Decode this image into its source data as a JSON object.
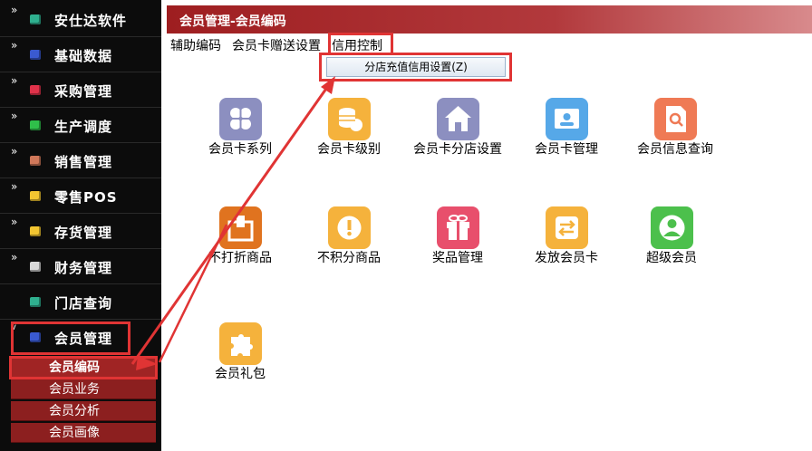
{
  "sidebar": {
    "items": [
      {
        "label": "安仕达软件",
        "color": "#2fb08f"
      },
      {
        "label": "基础数据",
        "color": "#3a5ad0"
      },
      {
        "label": "采购管理",
        "color": "#e0324a"
      },
      {
        "label": "生产调度",
        "color": "#2fbf4a"
      },
      {
        "label": "销售管理",
        "color": "#d0785a"
      },
      {
        "label": "零售POS",
        "color": "#f2c531"
      },
      {
        "label": "存货管理",
        "color": "#f2c531"
      },
      {
        "label": "财务管理",
        "color": "#d8d8d8"
      },
      {
        "label": "门店查询",
        "color": "#2fb08f"
      },
      {
        "label": "会员管理",
        "color": "#3a5ad0"
      }
    ],
    "subitems": [
      {
        "label": "会员编码"
      },
      {
        "label": "会员业务"
      },
      {
        "label": "会员分析"
      },
      {
        "label": "会员画像"
      }
    ]
  },
  "main": {
    "title": "会员管理-会员编码",
    "menu": [
      "辅助编码",
      "会员卡赠送设置",
      "信用控制"
    ],
    "dropdown_item": "分店充值信用设置(Z)",
    "tiles": [
      {
        "label": "会员卡系列",
        "icon": "grid-icon",
        "color": "#8c8fc0"
      },
      {
        "label": "会员卡级别",
        "icon": "coins-icon",
        "color": "#f5b23c"
      },
      {
        "label": "会员卡分店设置",
        "icon": "house-icon",
        "color": "#8c8fc0"
      },
      {
        "label": "会员卡管理",
        "icon": "id-card-icon",
        "color": "#56a8e8"
      },
      {
        "label": "会员信息查询",
        "icon": "doc-search-icon",
        "color": "#ef7a55"
      },
      {
        "label": "不打折商品",
        "icon": "box-icon",
        "color": "#e0731f"
      },
      {
        "label": "不积分商品",
        "icon": "exclaim-icon",
        "color": "#f5b23c"
      },
      {
        "label": "奖品管理",
        "icon": "gift-icon",
        "color": "#e84f6c"
      },
      {
        "label": "发放会员卡",
        "icon": "transfer-icon",
        "color": "#f5b23c"
      },
      {
        "label": "超级会员",
        "icon": "user-icon",
        "color": "#4cc04c"
      },
      {
        "label": "会员礼包",
        "icon": "puzzle-icon",
        "color": "#f5b23c"
      }
    ]
  }
}
